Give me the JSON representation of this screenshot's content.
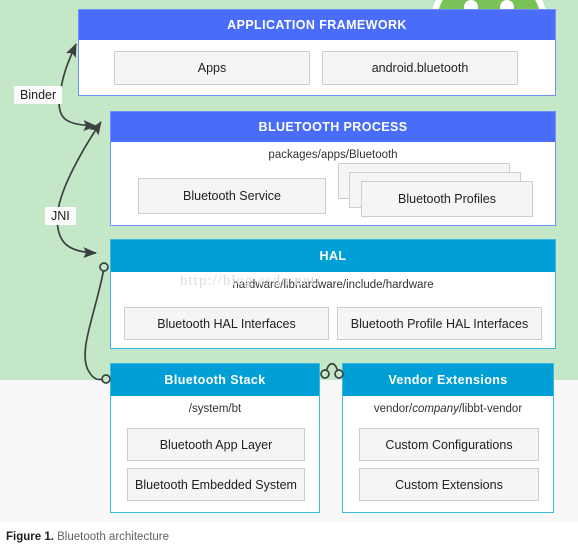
{
  "figure": {
    "label": "Figure 1.",
    "caption": "Bluetooth architecture"
  },
  "watermark": "http://blog.csdn.net/",
  "colors": {
    "background_green": "#c4e7c7",
    "background_white": "#f8f8f8",
    "header_blue": "#4a6cfa",
    "header_cyan": "#00a0d6",
    "chip_fill": "#f5f5f5",
    "chip_border": "#c9cfc9",
    "android_green": "#78c257",
    "wire": "#3c4043"
  },
  "connectors": [
    {
      "name": "binder",
      "label": "Binder"
    },
    {
      "name": "jni",
      "label": "JNI"
    }
  ],
  "layers": [
    {
      "id": "application-framework",
      "title": "APPLICATION FRAMEWORK",
      "accent": "blue",
      "path": "",
      "boxes": [
        "Apps",
        "android.bluetooth"
      ]
    },
    {
      "id": "bluetooth-process",
      "title": "BLUETOOTH PROCESS",
      "accent": "blue",
      "path": "packages/apps/Bluetooth",
      "boxes": [
        "Bluetooth Service",
        "Bluetooth Profiles"
      ]
    },
    {
      "id": "hal",
      "title": "HAL",
      "accent": "cyan",
      "path": "hardware/libhardware/include/hardware",
      "boxes": [
        "Bluetooth HAL Interfaces",
        "Bluetooth Profile HAL Interfaces"
      ]
    },
    {
      "id": "bluetooth-stack",
      "title": "Bluetooth Stack",
      "accent": "cyan",
      "path": "/system/bt",
      "boxes": [
        "Bluetooth App Layer",
        "Bluetooth Embedded System"
      ]
    },
    {
      "id": "vendor-extensions",
      "title": "Vendor Extensions",
      "accent": "cyan",
      "path_prefix": "vendor/",
      "path_italic": "company",
      "path_suffix": "/libbt-vendor",
      "boxes": [
        "Custom Configurations",
        "Custom Extensions"
      ]
    }
  ]
}
